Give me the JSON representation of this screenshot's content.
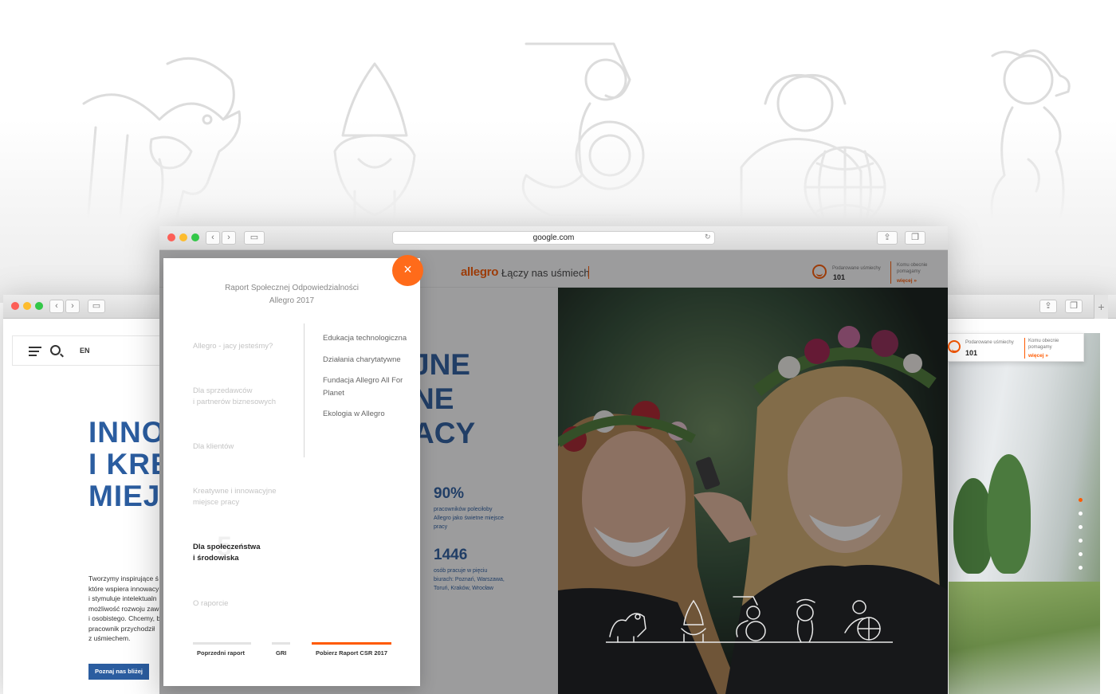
{
  "main_window": {
    "url": "google.com",
    "header": {
      "logo": "allegro",
      "tagline": "Łączy nas uśmiech",
      "smiles_label": "Podarowane uśmiechy",
      "smiles_count": "101",
      "help_label": "Komu obecnie pomagamy",
      "more_link": "więcej »"
    },
    "hero_heading_lines": [
      "JNE",
      "NE",
      "ACY"
    ],
    "stats": [
      {
        "value": "90%",
        "text": "pracowników poleciłoby Allegro jako świetne miejsce pracy"
      },
      {
        "value": "1446",
        "text": "osób pracuje w pięciu biurach: Poznań, Warszawa, Toruń, Kraków, Wrocław"
      }
    ]
  },
  "menu": {
    "title_line1": "Raport Społecznej Odpowiedzialności",
    "title_line2": "Allegro 2017",
    "close_icon": "×",
    "items": [
      "Allegro - jacy jesteśmy?",
      "Dla sprzedawców\ni partnerów biznesowych",
      "Dla klientów",
      "Kreatywne i innowacyjne\nmiejsce pracy",
      "Dla społeczeństwa\ni środowiska",
      "O raporcie"
    ],
    "active_number": "5",
    "sub_items": [
      "Edukacja technologiczna",
      "Działania charytatywne",
      "Fundacja Allegro All For Planet",
      "Ekologia w Allegro"
    ],
    "footer": {
      "prev": "Poprzedni raport",
      "gri": "GRI",
      "download": "Pobierz Raport CSR 2017"
    }
  },
  "left_window": {
    "lang": "EN",
    "heading_lines": [
      "INNO",
      "I KRE",
      "MIEJS"
    ],
    "body_lines": [
      "Tworzymy inspirujące ś",
      "które wspiera innowacy",
      "i stymuluje intelektualn",
      "możliwość rozwoju zaw",
      "i osobistego. Chcemy, b",
      "pracownik przychodził",
      "z uśmiechem."
    ],
    "button": "Poznaj nas bliżej"
  },
  "right_window": {
    "smiles_label": "Podarowane uśmiechy",
    "smiles_count": "101",
    "help_label": "Komu obecnie pomagamy",
    "more_link": "więcej »"
  },
  "colors": {
    "accent": "#ff5a00",
    "brand_blue": "#2b5da0"
  }
}
